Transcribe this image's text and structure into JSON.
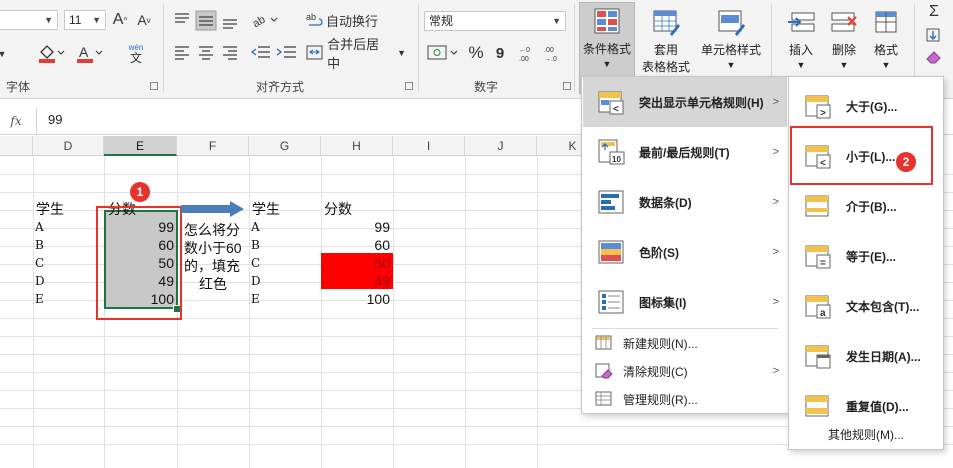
{
  "ribbon": {
    "font_size": "11",
    "grow_font": "A",
    "shrink_font": "A",
    "wen_label": "wén",
    "wen_char": "文",
    "font_group_label": "字体",
    "wrap_text_label": "自动换行",
    "merge_label": "合并后居中",
    "align_group_label": "对齐方式",
    "number_format": "常规",
    "percent_symbol": "%",
    "comma_symbol": "9",
    "number_group_label": "数字",
    "cond_format_label": "条件格式",
    "table_format_label1": "套用",
    "table_format_label2": "表格格式",
    "cell_style_label": "单元格样式",
    "insert_label": "插入",
    "delete_label": "删除",
    "format_label": "格式",
    "sum_symbol": "Σ"
  },
  "formula_bar": {
    "fx_label": "fx",
    "value": "99"
  },
  "columns": [
    "D",
    "E",
    "F",
    "G",
    "H",
    "I",
    "J",
    "K"
  ],
  "table_left": {
    "header_name": "学生",
    "header_score": "分数",
    "rows": [
      {
        "name": "A",
        "score": "99"
      },
      {
        "name": "B",
        "score": "60"
      },
      {
        "name": "C",
        "score": "50"
      },
      {
        "name": "D",
        "score": "49"
      },
      {
        "name": "E",
        "score": "100"
      }
    ]
  },
  "note": {
    "line1": "怎么将分",
    "line2": "数小于60",
    "line3": "的，填充",
    "line4": "红色"
  },
  "table_right": {
    "header_name": "学生",
    "header_score": "分数",
    "rows": [
      {
        "name": "A",
        "score": "99"
      },
      {
        "name": "B",
        "score": "60"
      },
      {
        "name": "C",
        "score": "50"
      },
      {
        "name": "D",
        "score": "49"
      },
      {
        "name": "E",
        "score": "100"
      }
    ]
  },
  "highlight_color": "#ff0000",
  "badge1": "1",
  "badge2": "2",
  "cond_menu": {
    "items": [
      {
        "label": "突出显示单元格规则(H)",
        "icon": "highlight-rules-icon"
      },
      {
        "label": "最前/最后规则(T)",
        "icon": "top-bottom-icon"
      },
      {
        "label": "数据条(D)",
        "icon": "data-bars-icon"
      },
      {
        "label": "色阶(S)",
        "icon": "color-scales-icon"
      },
      {
        "label": "图标集(I)",
        "icon": "icon-sets-icon"
      }
    ],
    "top_ten_badge": "10",
    "small_items": [
      {
        "label": "新建规则(N)..."
      },
      {
        "label": "清除规则(C)"
      },
      {
        "label": "管理规则(R)..."
      }
    ],
    "arrow": ">"
  },
  "sub_menu": {
    "items": [
      {
        "label": "大于(G)...",
        "icon": "greater-than-icon"
      },
      {
        "label": "小于(L)...",
        "icon": "less-than-icon"
      },
      {
        "label": "介于(B)...",
        "icon": "between-icon"
      },
      {
        "label": "等于(E)...",
        "icon": "equal-to-icon"
      },
      {
        "label": "文本包含(T)...",
        "icon": "text-contains-icon"
      },
      {
        "label": "发生日期(A)...",
        "icon": "date-occurring-icon"
      },
      {
        "label": "重复值(D)...",
        "icon": "duplicate-values-icon"
      }
    ],
    "more_rules": "其他规则(M)...",
    "gt_symbol": ">",
    "lt_symbol": "<",
    "eq_symbol": "=",
    "text_symbol": "a"
  },
  "colors": {
    "accent_green": "#217346",
    "badge_red": "#e8322d",
    "annotation_red": "#e8322d",
    "arrow_blue": "#4a7ebb",
    "selection_gray": "#c8c8c8"
  }
}
